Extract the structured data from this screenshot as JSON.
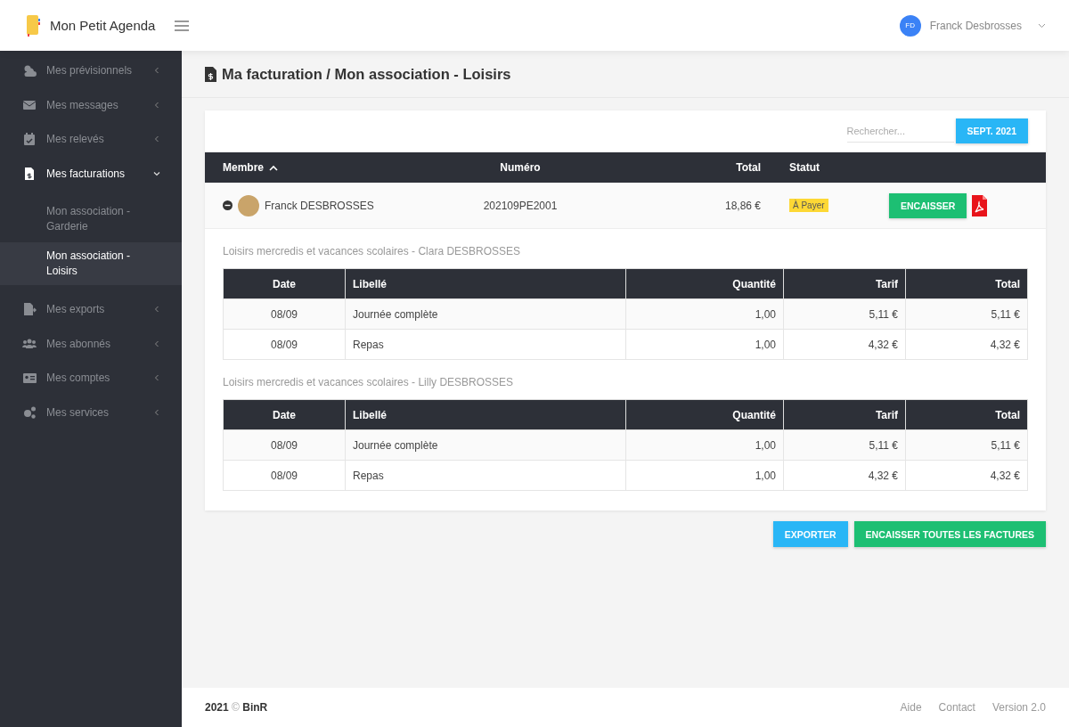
{
  "app": {
    "title": "Mon Petit Agenda"
  },
  "user": {
    "initials": "FD",
    "name": "Franck Desbrosses"
  },
  "sidebar": {
    "items": [
      {
        "label": "Mes prévisionnels",
        "expanded": false
      },
      {
        "label": "Mes messages",
        "expanded": false
      },
      {
        "label": "Mes relevés",
        "expanded": false
      },
      {
        "label": "Mes facturations",
        "expanded": true,
        "children": [
          {
            "label": "Mon association - Garderie",
            "selected": false
          },
          {
            "label": "Mon association - Loisirs",
            "selected": true
          }
        ]
      },
      {
        "label": "Mes exports",
        "expanded": false
      },
      {
        "label": "Mes abonnés",
        "expanded": false
      },
      {
        "label": "Mes comptes",
        "expanded": false
      },
      {
        "label": "Mes services",
        "expanded": false
      }
    ]
  },
  "page": {
    "title": "Ma facturation / Mon association - Loisirs"
  },
  "search": {
    "placeholder": "Rechercher..."
  },
  "month_button": "SEPT. 2021",
  "table": {
    "columns": [
      {
        "label": "Membre",
        "sorted": true
      },
      {
        "label": "Numéro",
        "sorted": false
      },
      {
        "label": "Total",
        "sorted": false
      },
      {
        "label": "Statut",
        "sorted": false
      }
    ],
    "rows": [
      {
        "expanded": true,
        "member": "Franck DESBROSSES",
        "number": "202109PE2001",
        "total": "18,86 €",
        "status": "À Payer",
        "action": "ENCAISSER"
      }
    ]
  },
  "details": [
    {
      "title": "Loisirs mercredis et vacances scolaires - Clara DESBROSSES",
      "columns": [
        "Date",
        "Libellé",
        "Quantité",
        "Tarif",
        "Total"
      ],
      "rows": [
        [
          "08/09",
          "Journée complète",
          "1,00",
          "5,11 €",
          "5,11 €"
        ],
        [
          "08/09",
          "Repas",
          "1,00",
          "4,32 €",
          "4,32 €"
        ]
      ]
    },
    {
      "title": "Loisirs mercredis et vacances scolaires - Lilly DESBROSSES",
      "columns": [
        "Date",
        "Libellé",
        "Quantité",
        "Tarif",
        "Total"
      ],
      "rows": [
        [
          "08/09",
          "Journée complète",
          "1,00",
          "5,11 €",
          "5,11 €"
        ],
        [
          "08/09",
          "Repas",
          "1,00",
          "4,32 €",
          "4,32 €"
        ]
      ]
    }
  ],
  "actions": [
    "EXPORTER",
    "ENCAISSER TOUTES LES FACTURES"
  ],
  "footer": {
    "copyright": "**2021** © **BinR**",
    "links": [
      "Aide",
      "Contact",
      "Version 2.0"
    ]
  }
}
